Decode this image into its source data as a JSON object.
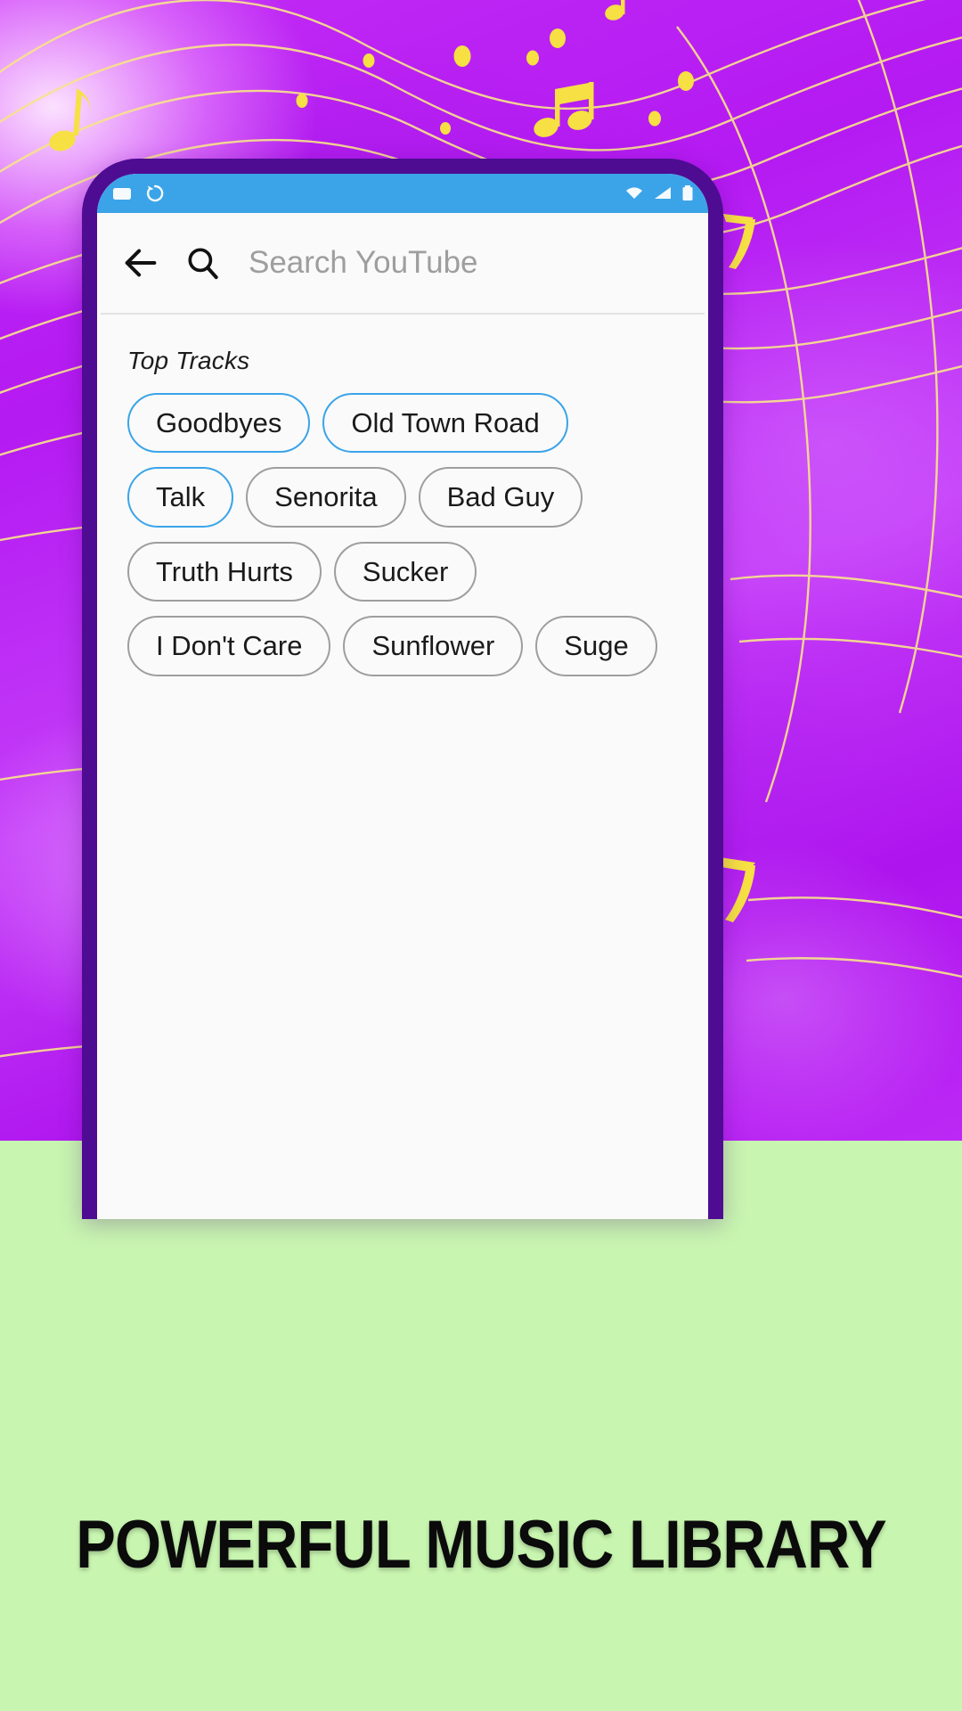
{
  "promo": {
    "headline": "POWERFUL MUSIC LIBRARY",
    "background_color": "#BB22F4",
    "bottom_band_color": "#C8F5B0",
    "phone_frame_color": "#4E0C92",
    "accent_color": "#3BA4E8",
    "note_color": "#F6E043"
  },
  "status_bar": {
    "background_color": "#3BA4E8",
    "left_icons": [
      "screenshot-icon",
      "sync-icon"
    ],
    "right_icons": [
      "wifi-icon",
      "signal-icon",
      "battery-icon"
    ]
  },
  "app_bar": {
    "back_icon": "back-arrow-icon",
    "search_icon": "search-icon",
    "search_value": "",
    "search_placeholder": "Search YouTube"
  },
  "content": {
    "section_label": "Top Tracks",
    "chips": [
      {
        "label": "Goodbyes",
        "accent": true
      },
      {
        "label": "Old Town Road",
        "accent": true
      },
      {
        "label": "Talk",
        "accent": true
      },
      {
        "label": "Senorita",
        "accent": false
      },
      {
        "label": "Bad Guy",
        "accent": false
      },
      {
        "label": "Truth Hurts",
        "accent": false
      },
      {
        "label": "Sucker",
        "accent": false
      },
      {
        "label": "I Don't Care",
        "accent": false
      },
      {
        "label": "Sunflower",
        "accent": false
      },
      {
        "label": "Suge",
        "accent": false
      }
    ]
  }
}
